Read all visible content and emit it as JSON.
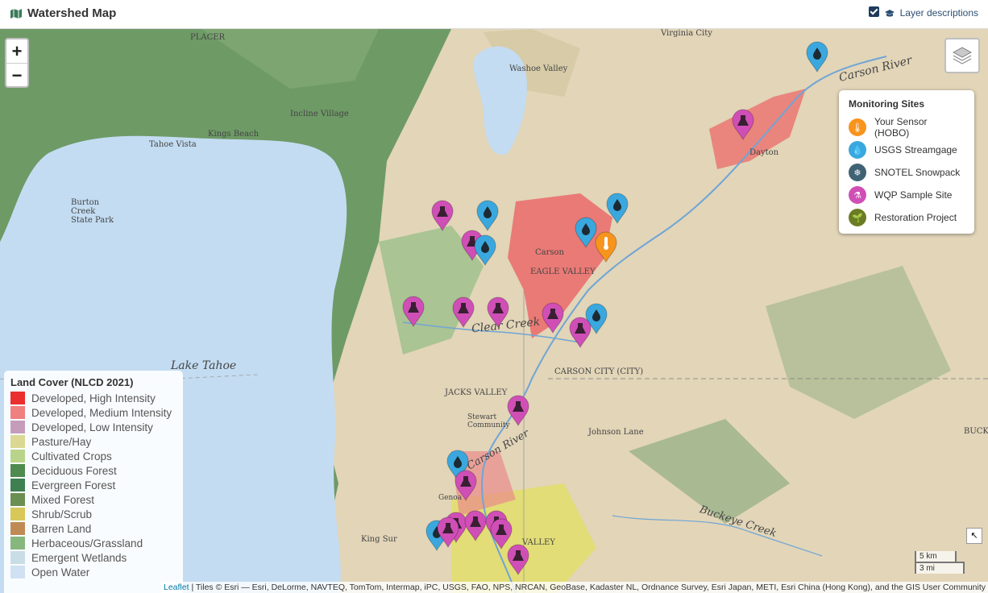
{
  "app": {
    "title": "Watershed Map",
    "layer_desc": "Layer descriptions",
    "layer_desc_checked": true
  },
  "zoom": {
    "in": "+",
    "out": "−"
  },
  "sites_legend": {
    "title": "Monitoring Sites",
    "items": [
      {
        "label": "Your Sensor (HOBO)",
        "color": "#f7941d",
        "icon": "thermometer-icon"
      },
      {
        "label": "USGS Streamgage",
        "color": "#3aa8de",
        "icon": "water-drop-icon"
      },
      {
        "label": "SNOTEL Snowpack",
        "color": "#3f6275",
        "icon": "snowflake-icon"
      },
      {
        "label": "WQP Sample Site",
        "color": "#d04fb6",
        "icon": "flask-icon"
      },
      {
        "label": "Restoration Project",
        "color": "#6b7c24",
        "icon": "seedling-icon"
      }
    ]
  },
  "landcover_legend": {
    "title": "Land Cover (NLCD 2021)",
    "items": [
      {
        "label": "Developed, High Intensity",
        "color": "#eb2e2e"
      },
      {
        "label": "Developed, Medium Intensity",
        "color": "#f07f7f"
      },
      {
        "label": "Developed, Low Intensity",
        "color": "#c59dba"
      },
      {
        "label": "Pasture/Hay",
        "color": "#dbd894"
      },
      {
        "label": "Cultivated Crops",
        "color": "#b9d48a"
      },
      {
        "label": "Deciduous Forest",
        "color": "#4f8a4f"
      },
      {
        "label": "Evergreen Forest",
        "color": "#3f7f52"
      },
      {
        "label": "Mixed Forest",
        "color": "#6b8f52"
      },
      {
        "label": "Shrub/Scrub",
        "color": "#d8c85a"
      },
      {
        "label": "Barren Land",
        "color": "#c08a55"
      },
      {
        "label": "Herbaceous/Grassland",
        "color": "#86b77e"
      },
      {
        "label": "Emergent Wetlands",
        "color": "#c9dde6"
      },
      {
        "label": "Open Water",
        "color": "#cfe1f2"
      }
    ]
  },
  "map_labels": {
    "lake_tahoe": "Lake Tahoe",
    "carson_river_n": "Carson River",
    "clear_creek": "Clear Creek",
    "carson_river_s": "Carson River",
    "buckeye_creek": "Buckeye Creek",
    "washoe_valley": "Washoe Valley",
    "carson_city": "CARSON CITY (CITY)",
    "jacks_valley": "JACKS VALLEY",
    "johnson_lane": "Johnson Lane",
    "virginia_city": "Virginia City",
    "placer": "PLACER",
    "kings_beach": "Kings Beach",
    "tahoe_vista": "Tahoe Vista",
    "dayton": "Dayton",
    "carson": "Carson",
    "valley": "VALLEY",
    "incline": "Incline Village",
    "buck": "BUCK",
    "king_sur": "King Sur",
    "eagle_valley": "EAGLE VALLEY",
    "burton": "Burton Creek State Park",
    "stewart": "Stewart Community",
    "genoa": "Genoa"
  },
  "markers": [
    {
      "type": "usgs",
      "icon": "water-drop-icon"
    },
    {
      "type": "wqp",
      "icon": "flask-icon"
    },
    {
      "type": "wqp",
      "icon": "flask-icon"
    },
    {
      "type": "usgs",
      "icon": "water-drop-icon"
    },
    {
      "type": "usgs",
      "icon": "water-drop-icon"
    },
    {
      "type": "wqp",
      "icon": "flask-icon"
    },
    {
      "type": "usgs",
      "icon": "water-drop-icon"
    },
    {
      "type": "usgs",
      "icon": "water-drop-icon"
    },
    {
      "type": "hobo",
      "icon": "thermometer-icon"
    },
    {
      "type": "wqp",
      "icon": "flask-icon"
    },
    {
      "type": "wqp",
      "icon": "flask-icon"
    },
    {
      "type": "wqp",
      "icon": "flask-icon"
    },
    {
      "type": "wqp",
      "icon": "flask-icon"
    },
    {
      "type": "usgs",
      "icon": "water-drop-icon"
    },
    {
      "type": "wqp",
      "icon": "flask-icon"
    },
    {
      "type": "wqp",
      "icon": "flask-icon"
    },
    {
      "type": "usgs",
      "icon": "water-drop-icon"
    },
    {
      "type": "wqp",
      "icon": "flask-icon"
    },
    {
      "type": "wqp",
      "icon": "flask-icon"
    },
    {
      "type": "wqp",
      "icon": "flask-icon"
    },
    {
      "type": "wqp",
      "icon": "flask-icon"
    },
    {
      "type": "usgs",
      "icon": "water-drop-icon"
    },
    {
      "type": "wqp",
      "icon": "flask-icon"
    },
    {
      "type": "wqp",
      "icon": "flask-icon"
    },
    {
      "type": "wqp",
      "icon": "flask-icon"
    }
  ],
  "scale": {
    "km": "5 km",
    "mi": "3 mi"
  },
  "attribution": {
    "leaflet": "Leaflet",
    "text": " | Tiles © Esri — Esri, DeLorme, NAVTEQ, TomTom, Intermap, iPC, USGS, FAO, NPS, NRCAN, GeoBase, Kadaster NL, Ordnance Survey, Esri Japan, METI, Esri China (Hong Kong), and the GIS User Community"
  }
}
